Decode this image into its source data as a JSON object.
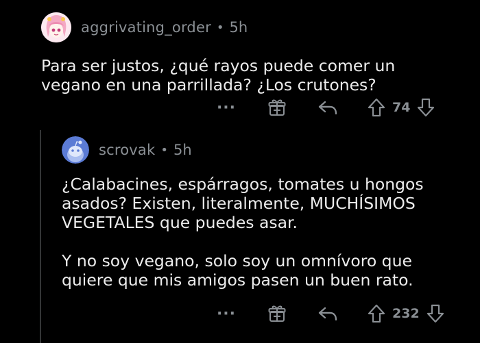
{
  "comments": [
    {
      "username": "aggrivating_order",
      "separator": "•",
      "time": "5h",
      "text": "Para ser justos, ¿qué rayos puede comer un\nvegano en una parrillada? ¿Los crutones?",
      "votes": "74",
      "more_label": "···"
    },
    {
      "username": "scrovak",
      "separator": "•",
      "time": "5h",
      "text": "¿Calabacines, espárragos, tomates u hongos\nasados? Existen, literalmente, MUCHÍSIMOS\nVEGETALES que puedes asar.\n\nY no soy vegano, solo soy un omnívoro que\nquiere que mis amigos pasen un buen rato.",
      "votes": "232",
      "more_label": "···"
    }
  ],
  "icons": [
    "more-options-icon",
    "award-icon",
    "reply-icon",
    "upvote-icon",
    "downvote-icon"
  ],
  "colors": {
    "background": "#000000",
    "meta": "#8a8f94",
    "text": "#ececec",
    "thread_line": "#343536",
    "avatar2": "#5b7bd5"
  }
}
